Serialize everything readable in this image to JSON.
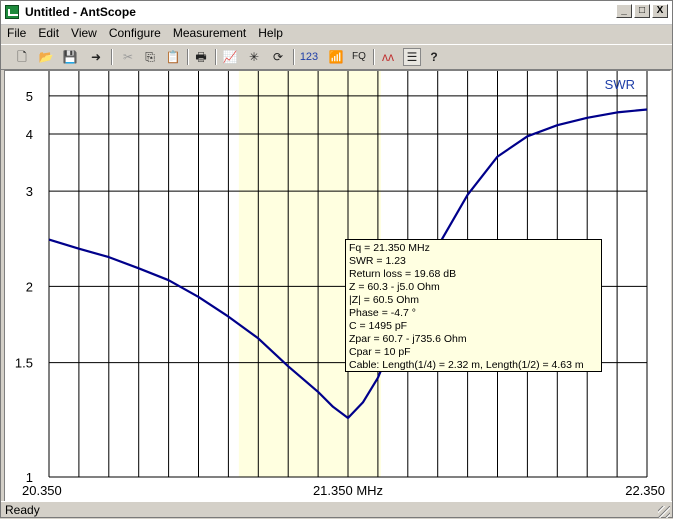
{
  "window": {
    "title": "Untitled - AntScope",
    "min": "_",
    "max": "□",
    "close": "X"
  },
  "menu": [
    "File",
    "Edit",
    "View",
    "Configure",
    "Measurement",
    "Help"
  ],
  "toolbar": {
    "new": "🗋",
    "open": "📂",
    "save": "💾",
    "export": "➜",
    "cut": "✂",
    "copy": "⎘",
    "paste": "📋",
    "print": "🖶",
    "chart": "📈",
    "scan": "✳",
    "refresh": "⟳",
    "numbers": "123",
    "wireless": "📶",
    "fq": "FQ",
    "overlay": "ᴧᴧ",
    "list": "☰",
    "help": "?"
  },
  "status": {
    "text": "Ready"
  },
  "tooltip": {
    "lines": [
      "Fq = 21.350 MHz",
      "SWR = 1.23",
      "Return loss = 19.68 dB",
      "Z = 60.3 - j5.0 Ohm",
      "|Z| = 60.5 Ohm",
      "Phase = -4.7 °",
      "C = 1495 pF",
      "Zpar = 60.7 - j735.6 Ohm",
      "Cpar = 10 pF",
      "Cable: Length(1/4) = 2.32 m, Length(1/2) = 4.63 m"
    ]
  },
  "chart_data": {
    "type": "line",
    "series_label": "SWR",
    "x_labels": [
      "20.350",
      "21.350 MHz",
      "22.350"
    ],
    "xlim": [
      20.35,
      22.35
    ],
    "y_ticks": [
      1,
      1.5,
      2,
      3,
      4,
      5
    ],
    "ylim_display": [
      1,
      5.9
    ],
    "band_highlight": [
      20.985,
      21.46
    ],
    "series": [
      {
        "color": "#00008b",
        "x": [
          20.35,
          20.45,
          20.55,
          20.65,
          20.75,
          20.85,
          20.95,
          21.05,
          21.15,
          21.25,
          21.3,
          21.35,
          21.4,
          21.45,
          21.55,
          21.65,
          21.75,
          21.85,
          21.95,
          22.05,
          22.15,
          22.25,
          22.35
        ],
        "y": [
          2.42,
          2.33,
          2.25,
          2.15,
          2.05,
          1.92,
          1.78,
          1.64,
          1.48,
          1.35,
          1.28,
          1.23,
          1.3,
          1.42,
          1.85,
          2.35,
          2.95,
          3.55,
          3.95,
          4.2,
          4.38,
          4.52,
          4.6
        ]
      }
    ]
  }
}
